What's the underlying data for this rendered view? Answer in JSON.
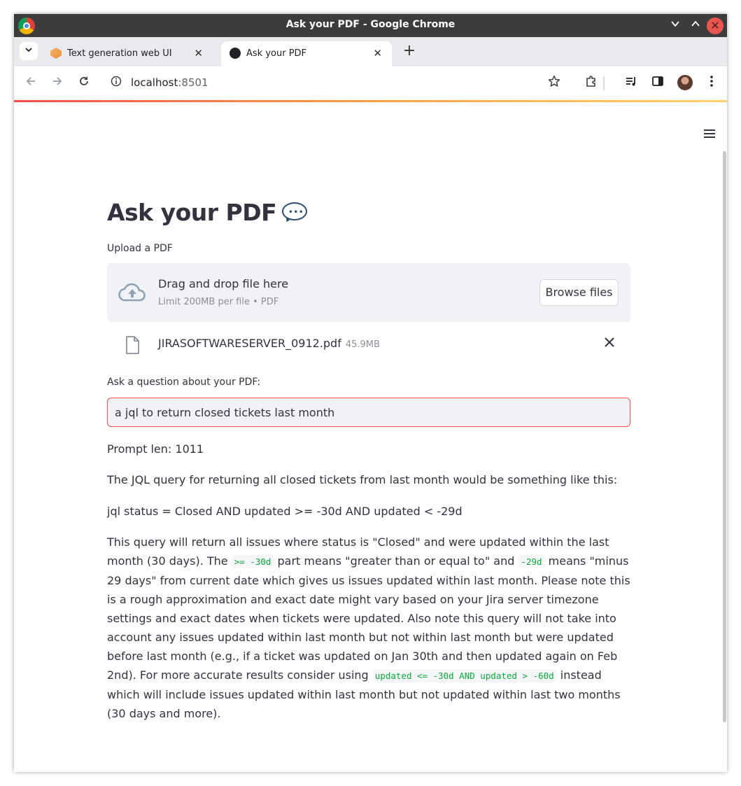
{
  "window": {
    "title": "Ask your PDF - Google Chrome"
  },
  "tabs": [
    {
      "label": "Text generation web UI",
      "active": false
    },
    {
      "label": "Ask your PDF",
      "active": true
    }
  ],
  "toolbar": {
    "url_host": "localhost",
    "url_port": ":8501"
  },
  "app": {
    "title": "Ask your PDF",
    "title_emoji": "speech-bubble-icon",
    "uploader": {
      "label": "Upload a PDF",
      "drop_text": "Drag and drop file here",
      "limit_text": "Limit 200MB per file • PDF",
      "browse_label": "Browse files"
    },
    "file": {
      "name": "JIRASOFTWARESERVER_0912.pdf",
      "size": "45.9MB"
    },
    "question": {
      "label": "Ask a question about your PDF:",
      "value": "a jql to return closed tickets last month"
    },
    "output": {
      "prompt_len": "Prompt len: 1011",
      "intro": "The JQL query for returning all closed tickets from last month would be something like this:",
      "jql": "jql status = Closed AND updated >= -30d AND updated < -29d",
      "explanation": {
        "p1": "This query will return all issues where status is \"Closed\" and were updated within the last month (30 days). The ",
        "code1": ">= -30d",
        "p2": " part means \"greater than or equal to\" and ",
        "code2": "-29d",
        "p3": " means \"minus 29 days\" from current date which gives us issues updated within last month. Please note this is a rough approximation and exact date might vary based on your Jira server timezone settings and exact dates when tickets were updated. Also note this query will not take into account any issues updated within last month but not within last month but were updated before last month (e.g., if a ticket was updated on Jan 30th and then updated again on Feb 2nd). For more accurate results consider using ",
        "code3": "updated <= -30d AND updated > -60d",
        "p4": " instead which will include issues updated within last month but not updated within last two months (30 days and more)."
      }
    }
  },
  "colors": {
    "accent": "#ff4b4b",
    "text": "#31333f",
    "code": "#09ab3b",
    "panel": "#f0f2f6"
  }
}
